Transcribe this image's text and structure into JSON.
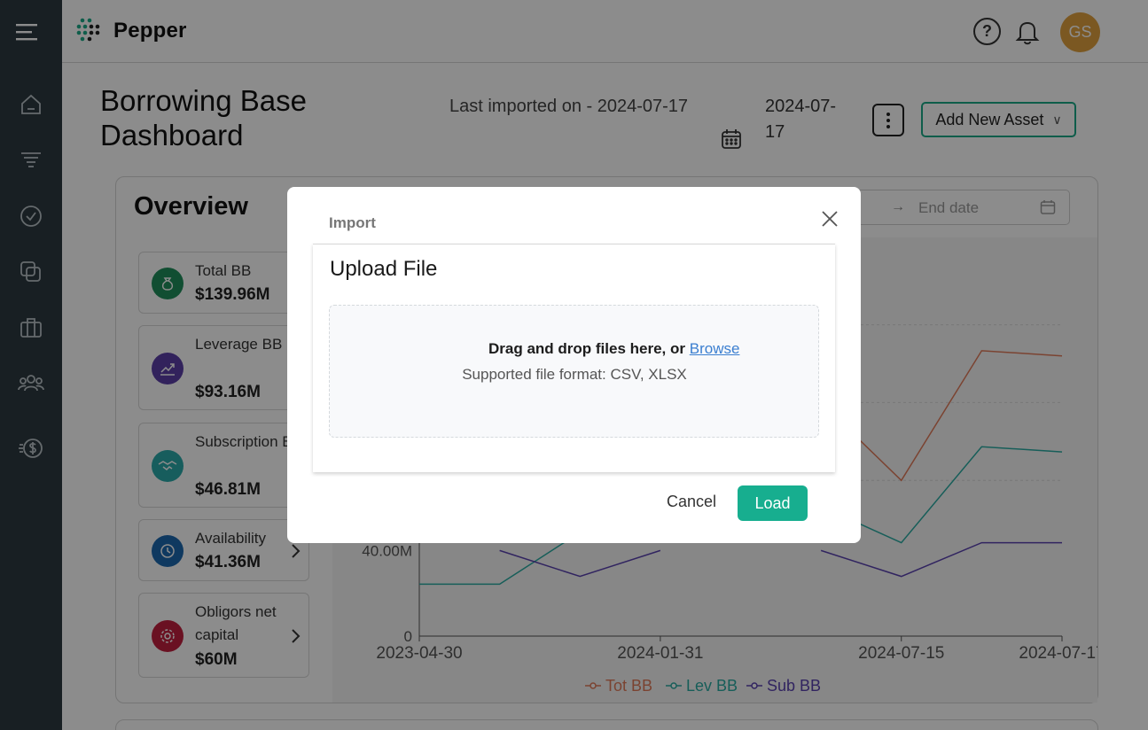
{
  "app": {
    "brand": "Pepper",
    "user_initials": "GS",
    "help_symbol": "?"
  },
  "header": {
    "title": "Borrowing Base Dashboard",
    "last_imported": "Last imported on - 2024-07-17",
    "selected_date": "2024-07-17",
    "add_asset_label": "Add New Asset",
    "add_asset_chevron": "∨"
  },
  "sidebar": {
    "items": [
      {
        "icon": "home-icon"
      },
      {
        "icon": "funnel-icon"
      },
      {
        "icon": "check-circle-icon"
      },
      {
        "icon": "layers-icon"
      },
      {
        "icon": "briefcase-icon"
      },
      {
        "icon": "users-icon"
      },
      {
        "icon": "dollar-coin-icon"
      }
    ]
  },
  "overview": {
    "title": "Overview",
    "date_range": {
      "arrow": "→",
      "end_placeholder": "End date"
    },
    "cards": [
      {
        "label": "Total BB",
        "value": "$139.96M",
        "color": "#1f8f5c"
      },
      {
        "label": "Leverage BB",
        "value": "$93.16M",
        "color": "#5b3fa8"
      },
      {
        "label": "Subscription BB",
        "value": "$46.81M",
        "color": "#2aa9a9"
      },
      {
        "label": "Availability",
        "value": "$41.36M",
        "color": "#1c68b0"
      },
      {
        "label": "Obligors net capital",
        "value": "$60M",
        "color": "#c2203f"
      }
    ]
  },
  "chart_data": {
    "type": "line",
    "x": [
      "2023-04-30",
      "",
      "",
      "2024-01-31",
      "",
      "",
      "2024-07-15",
      "",
      "2024-07-17"
    ],
    "tick_labels": [
      "2023-04-30",
      "2024-01-31",
      "2024-07-15",
      "2024-07-17"
    ],
    "y_tick_labels": [
      "0",
      "40.00M"
    ],
    "ylim": [
      0,
      140
    ],
    "series": [
      {
        "name": "Tot BB",
        "color": "#e07b5a",
        "values": [
          null,
          null,
          null,
          null,
          null,
          90,
          60,
          110,
          108
        ]
      },
      {
        "name": "Lev BB",
        "color": "#2aaca3",
        "values": [
          20,
          20,
          40,
          null,
          null,
          50,
          36,
          73,
          71
        ]
      },
      {
        "name": "Sub BB",
        "color": "#5a42b0",
        "values": [
          null,
          33,
          23,
          33,
          null,
          33,
          23,
          36,
          36
        ]
      }
    ],
    "legend": "bottom"
  },
  "modal": {
    "header": "Import",
    "title": "Upload File",
    "drop_text": "Drag and drop files here, or",
    "browse": "Browse",
    "formats": "Supported file format: CSV, XLSX",
    "cancel": "Cancel",
    "load": "Load"
  }
}
